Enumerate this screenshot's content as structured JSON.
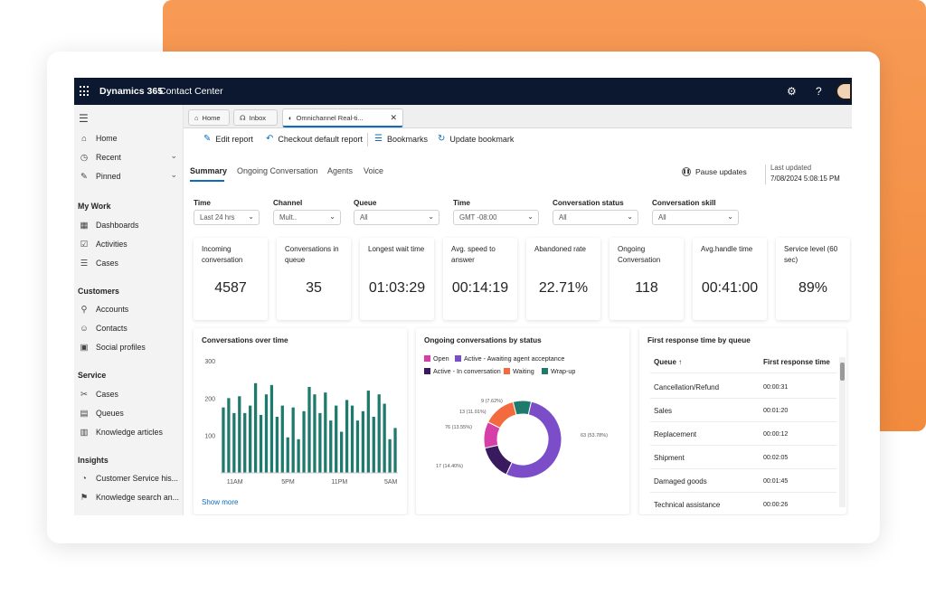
{
  "topbar": {
    "brand": "Dynamics 365",
    "product": "Contact Center",
    "settings_icon": "gear-icon",
    "help_label": "?"
  },
  "sidebar": {
    "primary": [
      {
        "label": "Home",
        "icon": "home-icon"
      },
      {
        "label": "Recent",
        "icon": "clock-icon"
      },
      {
        "label": "Pinned",
        "icon": "pin-icon"
      }
    ],
    "sections": [
      {
        "title": "My Work",
        "items": [
          {
            "label": "Dashboards",
            "icon": "dashboard-icon"
          },
          {
            "label": "Activities",
            "icon": "activities-icon"
          },
          {
            "label": "Cases",
            "icon": "cases-icon"
          }
        ]
      },
      {
        "title": "Customers",
        "items": [
          {
            "label": "Accounts",
            "icon": "accounts-icon"
          },
          {
            "label": "Contacts",
            "icon": "contacts-icon"
          },
          {
            "label": "Social profiles",
            "icon": "social-profiles-icon"
          }
        ]
      },
      {
        "title": "Service",
        "items": [
          {
            "label": "Cases",
            "icon": "wrench-icon"
          },
          {
            "label": "Queues",
            "icon": "queues-icon"
          },
          {
            "label": "Knowledge articles",
            "icon": "book-icon"
          }
        ]
      },
      {
        "title": "Insights",
        "items": [
          {
            "label": "Customer Service his...",
            "icon": "insights-icon"
          },
          {
            "label": "Knowledge search an...",
            "icon": "search-analytics-icon"
          }
        ]
      }
    ]
  },
  "browser_tabs": [
    {
      "label": "Home"
    },
    {
      "label": "Inbox"
    },
    {
      "label": "Omnichannel Real-ti..."
    }
  ],
  "toolbar": {
    "edit_report": "Edit report",
    "checkout_default": "Checkout default report",
    "bookmarks": "Bookmarks",
    "update_bookmark": "Update bookmark"
  },
  "subtabs": [
    "Summary",
    "Ongoing Conversation",
    "Agents",
    "Voice"
  ],
  "pause_updates": "Pause updates",
  "last_updated": {
    "label": "Last updated",
    "value": "7/08/2024 5:08:15 PM"
  },
  "filters": [
    {
      "label": "Time",
      "value": "Last 24 hrs"
    },
    {
      "label": "Channel",
      "value": "Mult.."
    },
    {
      "label": "Queue",
      "value": "All"
    },
    {
      "label": "Time",
      "value": "GMT -08:00"
    },
    {
      "label": "Conversation status",
      "value": "All"
    },
    {
      "label": "Conversation skill",
      "value": "All"
    }
  ],
  "kpis": [
    {
      "label": "Incoming conversation",
      "value": "4587"
    },
    {
      "label": "Conversations in queue",
      "value": "35"
    },
    {
      "label": "Longest wait time",
      "value": "01:03:29"
    },
    {
      "label": "Avg. speed to answer",
      "value": "00:14:19"
    },
    {
      "label": "Abandoned rate",
      "value": "22.71%"
    },
    {
      "label": "Ongoing Conversation",
      "value": "118"
    },
    {
      "label": "Avg.handle time",
      "value": "00:41:00"
    },
    {
      "label": "Service level (60 sec)",
      "value": "89%"
    }
  ],
  "panels": {
    "bar_title": "Conversations over time",
    "show_more": "Show more",
    "donut_title": "Ongoing conversations by status",
    "table_title": "First response time by queue",
    "table_col_queue": "Queue",
    "table_col_time": "First response time",
    "table_rows": [
      {
        "queue": "Cancellation/Refund",
        "time": "00:00:31"
      },
      {
        "queue": "Sales",
        "time": "00:01:20"
      },
      {
        "queue": "Replacement",
        "time": "00:00:12"
      },
      {
        "queue": "Shipment",
        "time": "00:02:05"
      },
      {
        "queue": "Damaged goods",
        "time": "00:01:45"
      },
      {
        "queue": "Technical assistance",
        "time": "00:00:26"
      }
    ]
  },
  "chart_data": [
    {
      "type": "bar",
      "title": "Conversations over time",
      "ylim": [
        0,
        300
      ],
      "yticks": [
        100,
        200,
        300
      ],
      "xticks": [
        "11AM",
        "5PM",
        "11PM",
        "5AM"
      ],
      "color": "#1f7a6e",
      "values": [
        175,
        200,
        160,
        205,
        160,
        180,
        240,
        155,
        210,
        235,
        150,
        180,
        95,
        175,
        90,
        165,
        230,
        210,
        160,
        215,
        140,
        180,
        110,
        195,
        180,
        140,
        165,
        220,
        150,
        210,
        185,
        90,
        120
      ]
    },
    {
      "type": "pie",
      "title": "Ongoing conversations by status",
      "legend": [
        "Open",
        "Active - Awaiting agent acceptance",
        "Active - In conversation",
        "Waiting",
        "Wrap-up"
      ],
      "colors": [
        "#d63fa7",
        "#7c4dc9",
        "#3a1a5e",
        "#f26a3d",
        "#1f7a6e"
      ],
      "slices": [
        {
          "label": "Open",
          "value": 13,
          "percent": "11.01%",
          "color": "#d63fa7"
        },
        {
          "label": "Active - Awaiting agent acceptance",
          "value": 63,
          "percent": "53.78%",
          "color": "#7c4dc9"
        },
        {
          "label": "Active - In conversation",
          "value": 17,
          "percent": "14.40%",
          "color": "#3a1a5e"
        },
        {
          "label": "Waiting",
          "value": 16,
          "percent": "13.55%",
          "color": "#f26a3d"
        },
        {
          "label": "Wrap-up",
          "value": 9,
          "percent": "7.62%",
          "color": "#1f7a6e"
        }
      ],
      "annotations": [
        "9 (7.62%)",
        "13 (11.01%)",
        "76 (13.55%)",
        "63 (53.78%)",
        "17 (14.40%)"
      ]
    }
  ]
}
